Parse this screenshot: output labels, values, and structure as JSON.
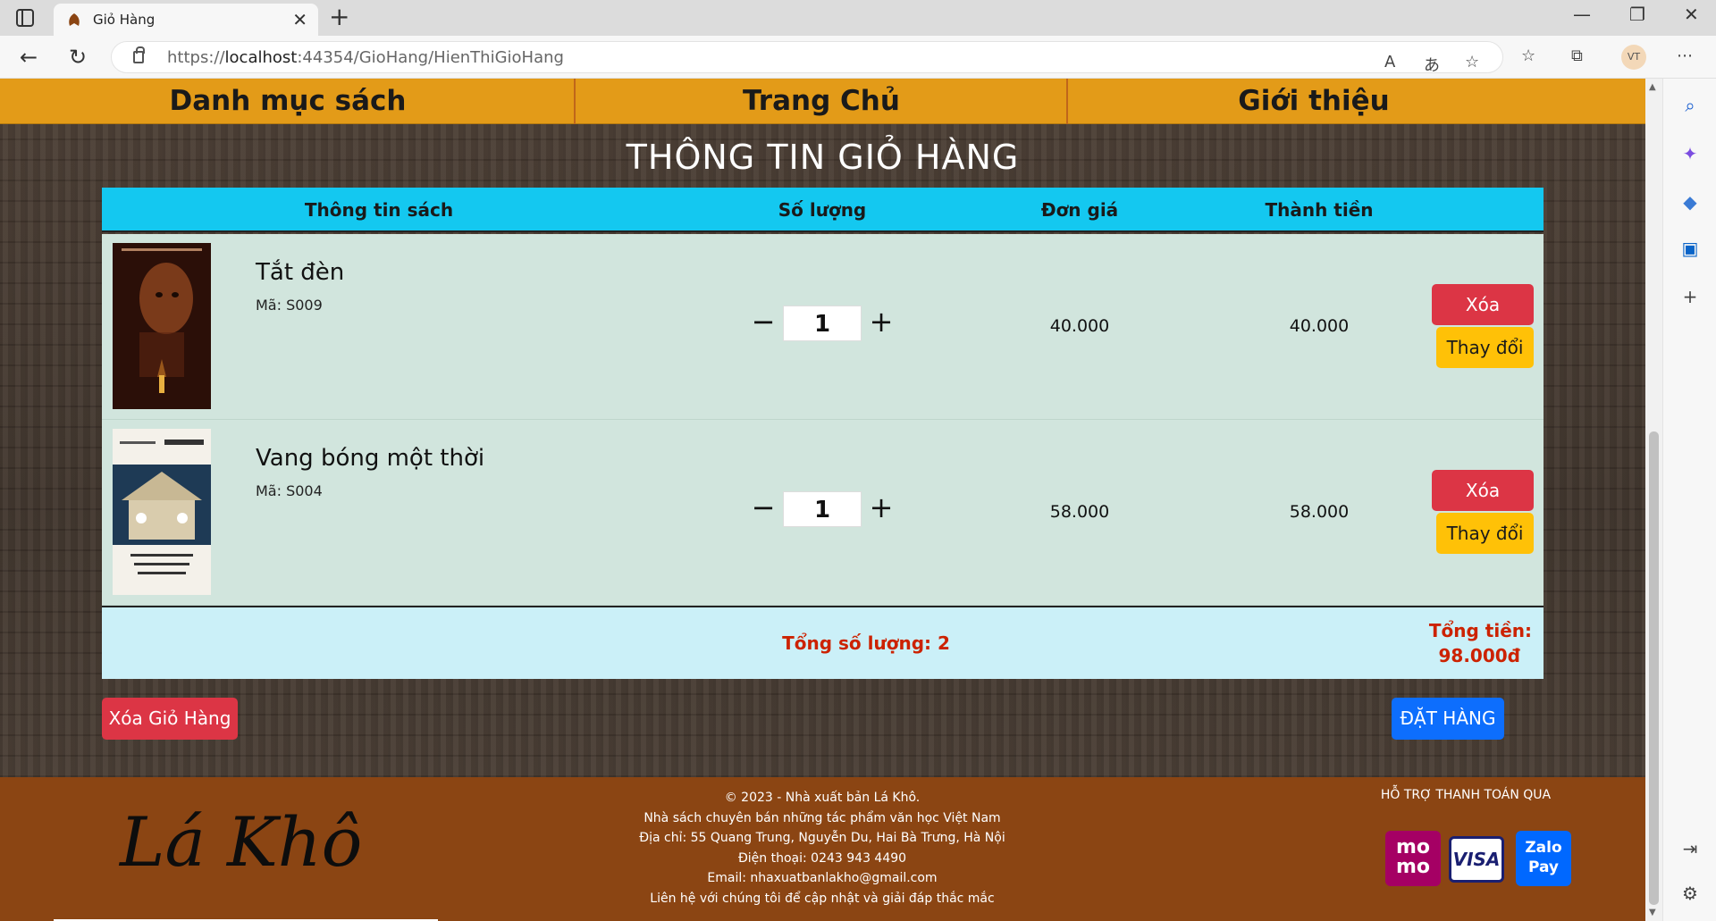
{
  "browser": {
    "tab_title": "Giỏ Hàng",
    "url_prefix": "https://",
    "url_host": "localhost",
    "url_rest": ":44354/GioHang/HienThiGioHang",
    "profile_initials": "VT"
  },
  "nav": {
    "items": [
      "Danh mục sách",
      "Trang Chủ",
      "Giới thiệu"
    ]
  },
  "page": {
    "heading": "THÔNG TIN GIỎ HÀNG"
  },
  "table": {
    "headers": {
      "info": "Thông tin sách",
      "qty": "Số lượng",
      "price": "Đơn giá",
      "total": "Thành tiền"
    },
    "rows": [
      {
        "title": "Tắt đèn",
        "code": "Mã: S009",
        "qty": "1",
        "price": "40.000",
        "total": "40.000",
        "delete_label": "Xóa",
        "change_label": "Thay đổi"
      },
      {
        "title": "Vang bóng một thời",
        "code": "Mã: S004",
        "qty": "1",
        "price": "58.000",
        "total": "58.000",
        "delete_label": "Xóa",
        "change_label": "Thay đổi"
      }
    ],
    "summary": {
      "total_qty": "Tổng số lượng: 2",
      "total_label": "Tổng tiền:",
      "total_amount": "98.000đ"
    }
  },
  "actions": {
    "clear_cart": "Xóa Giỏ Hàng",
    "order": "ĐẶT HÀNG"
  },
  "footer": {
    "brand": "Lá Khô",
    "lines": [
      "© 2023 - Nhà xuất bản Lá Khô.",
      "Nhà sách chuyên bán những tác phẩm văn học Việt Nam",
      "Địa chỉ: 55 Quang Trung, Nguyễn Du, Hai Bà Trưng, Hà Nội",
      "Điện thoại: 0243 943 4490",
      "Email: nhaxuatbanlakho@gmail.com",
      "Liên hệ với chúng tôi để cập nhật và giải đáp thắc mắc"
    ],
    "payment_title": "HỖ TRỢ THANH TOÁN QUA",
    "payment_logos": {
      "momo_top": "mo",
      "momo_bottom": "mo",
      "visa": "VISA",
      "zalo_top": "Zalo",
      "zalo_bottom": "Pay"
    }
  },
  "colors": {
    "nav_bg": "#e39b18",
    "table_header": "#14c8f0",
    "row_bg": "#d1e5dd",
    "summary_bg": "#cbf0f8",
    "danger": "#dc3545",
    "warning": "#ffc107",
    "primary": "#0d6efd",
    "footer_bg": "#8b4513",
    "total_text": "#cc2200"
  }
}
